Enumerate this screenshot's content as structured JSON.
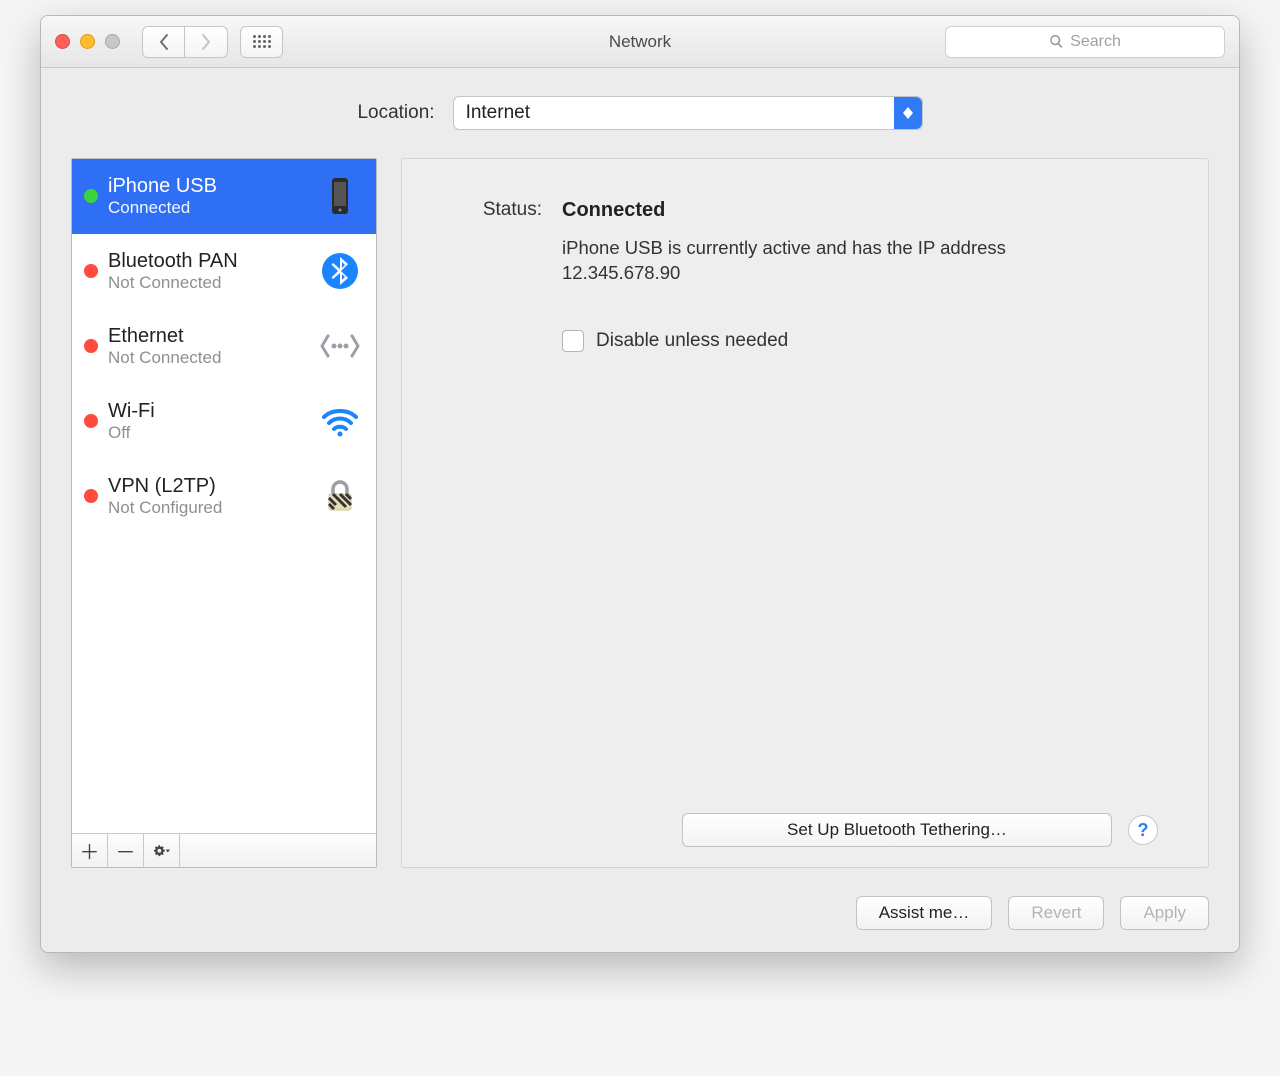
{
  "window": {
    "title": "Network"
  },
  "search": {
    "placeholder": "Search"
  },
  "location": {
    "label": "Location:",
    "value": "Internet"
  },
  "interfaces": [
    {
      "name": "iPhone USB",
      "status": "Connected",
      "dot": "green",
      "icon": "iphone",
      "selected": true
    },
    {
      "name": "Bluetooth PAN",
      "status": "Not Connected",
      "dot": "red",
      "icon": "bluetooth",
      "selected": false
    },
    {
      "name": "Ethernet",
      "status": "Not Connected",
      "dot": "red",
      "icon": "ethernet",
      "selected": false
    },
    {
      "name": "Wi-Fi",
      "status": "Off",
      "dot": "red",
      "icon": "wifi",
      "selected": false
    },
    {
      "name": "VPN (L2TP)",
      "status": "Not Configured",
      "dot": "red",
      "icon": "vpn",
      "selected": false
    }
  ],
  "detail": {
    "status_label": "Status:",
    "status_value": "Connected",
    "status_desc": "iPhone USB is currently active and has the IP address 12.345.678.90",
    "checkbox_label": "Disable unless needed",
    "setup_button": "Set Up Bluetooth Tethering…"
  },
  "footer": {
    "assist": "Assist me…",
    "revert": "Revert",
    "apply": "Apply"
  }
}
